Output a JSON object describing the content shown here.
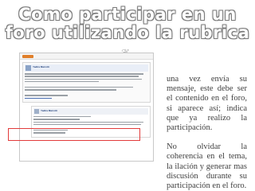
{
  "title": {
    "line1": "Como participar en un",
    "line2": "foro utilizando la rubrica"
  },
  "ornament": "❦",
  "screenshot": {
    "author_name": "Yadira Marrotti",
    "reply_author": "Yadira Marrotti"
  },
  "paragraphs": [
    "una vez envía su mensaje, este debe ser el contenido en el foro, si aparece así; indica que ya realizo la participación.",
    "No olvidar la coherencia en el tema, la ilación y generar mas discusión durante su participación en el foro."
  ],
  "colors": {
    "title_outline": "#7a7a7a",
    "highlight_border": "#e23b3b",
    "body_text": "#404040"
  }
}
